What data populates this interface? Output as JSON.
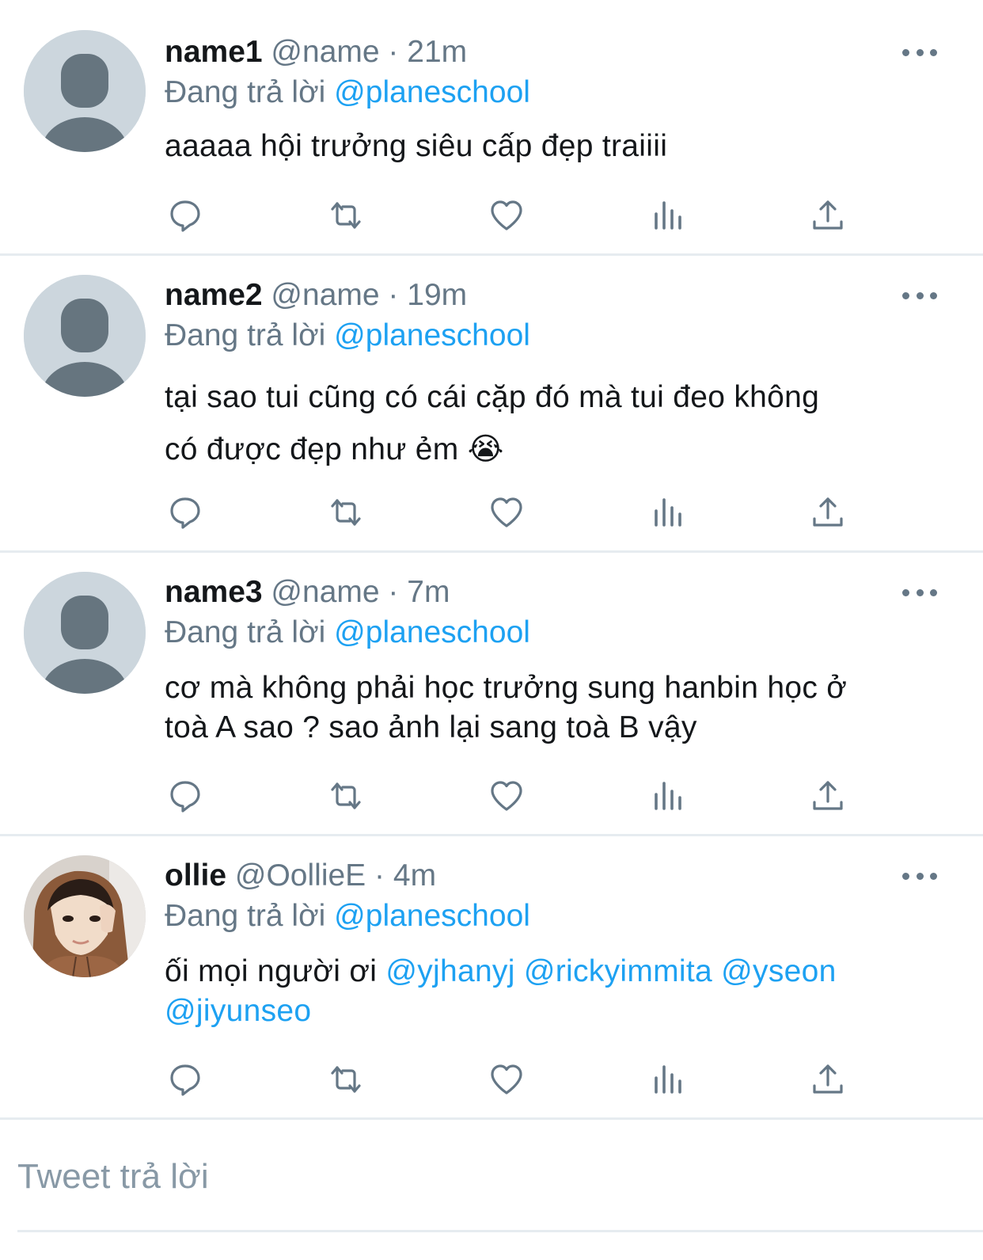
{
  "colors": {
    "text": "#14171a",
    "secondary": "#657786",
    "link": "#1da1f2",
    "divider": "#e6ecf0",
    "placeholder_avatar_bg": "#ccd6dd",
    "placeholder_avatar_fg": "#66757f"
  },
  "icons": {
    "reply": "reply-icon",
    "retweet": "retweet-icon",
    "like": "heart-icon",
    "analytics": "analytics-icon",
    "share": "share-icon",
    "more": "more-icon"
  },
  "replies": [
    {
      "name": "name1",
      "handle": "@name",
      "time": "21m",
      "reply_prefix": "Đang trả lời",
      "reply_to": "@planeschool",
      "text": "aaaaa hội trưởng siêu cấp đẹp traiiii",
      "avatar": "default"
    },
    {
      "name": "name2",
      "handle": "@name",
      "time": "19m",
      "reply_prefix": "Đang trả lời",
      "reply_to": "@planeschool",
      "text_line1": "tại sao tui cũng có cái cặp đó mà tui đeo không",
      "text_line2": "có được đẹp như ẻm",
      "emoji": "😭",
      "avatar": "default"
    },
    {
      "name": "name3",
      "handle": "@name",
      "time": "7m",
      "reply_prefix": "Đang trả lời",
      "reply_to": "@planeschool",
      "text_line1": "cơ mà không phải học trưởng sung hanbin học ở",
      "text_line2": "toà A sao ? sao ảnh lại sang toà B vậy",
      "avatar": "default"
    },
    {
      "name": "ollie",
      "handle": "@OollieE",
      "time": "4m",
      "reply_prefix": "Đang trả lời",
      "reply_to": "@planeschool",
      "text_prefix": "ối mọi người ơi",
      "mentions": [
        "@yjhanyj",
        "@rickyimmita",
        "@yseon",
        "@jiyunseo"
      ],
      "avatar": "photo"
    }
  ],
  "reply_composer": {
    "placeholder": "Tweet trả lời"
  }
}
